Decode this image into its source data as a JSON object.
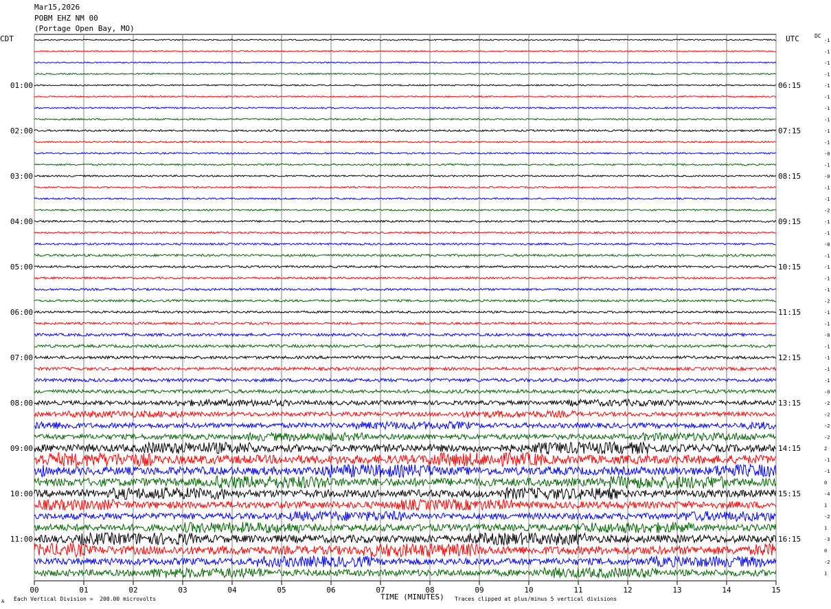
{
  "header": {
    "date": "Mar15,2026",
    "station": "POBM EHZ NM 00",
    "location": "(Portage Open Bay, MO)"
  },
  "left_zone": "CDT",
  "right_zone": "UTC",
  "dc_label": "DC",
  "footer": {
    "scale_note": "Each Vertical Division =  200.00 microvolts",
    "clip_note": "Traces clipped at plus/minus 5 vertical divisions",
    "corner_mark": "A"
  },
  "colors": {
    "trace_cycle": [
      "#000000",
      "#ff0000",
      "#0000ff",
      "#006400"
    ],
    "grid": "#808080"
  },
  "chart_data": {
    "type": "line",
    "title": "",
    "xlabel": "TIME (MINUTES)",
    "ylabel": "",
    "xlim": [
      0,
      15
    ],
    "x_tick_labels": [
      "00",
      "01",
      "02",
      "03",
      "04",
      "05",
      "06",
      "07",
      "08",
      "09",
      "10",
      "11",
      "12",
      "13",
      "14",
      "15"
    ],
    "rows": 48,
    "minutes_per_row": 15,
    "left_hour_labels": [
      "01:00",
      "02:00",
      "03:00",
      "04:00",
      "05:00",
      "06:00",
      "07:00",
      "08:00",
      "09:00",
      "10:00",
      "11:00"
    ],
    "right_hour_labels": [
      "06:15",
      "07:15",
      "08:15",
      "09:15",
      "10:15",
      "11:15",
      "12:15",
      "13:15",
      "14:15",
      "15:15",
      "16:15"
    ],
    "dc_offsets": [
      "-1",
      "-1",
      "-1",
      "-1",
      "-1",
      "-1",
      "-1",
      "-1",
      "-1",
      "-1",
      "-0",
      "-1",
      "-0",
      "-1",
      "-1",
      "-2",
      "-1",
      "-1",
      "-0",
      "-1",
      "-1",
      "-1",
      "-1",
      "-2",
      "-1",
      "-1",
      "-0",
      "-1",
      "-1",
      "-1",
      "-1",
      "-0",
      "-2",
      "-2",
      "-2",
      "-2",
      "2",
      "-1",
      "-1",
      "0",
      "-4",
      "1",
      "-2",
      "1",
      "-3",
      "0",
      "-2",
      "1"
    ],
    "row_amplitude_relative": [
      1,
      1,
      1,
      1.1,
      1.1,
      1.1,
      1.2,
      1.3,
      1.5,
      1.3,
      1.3,
      1.3,
      1.3,
      1.3,
      1.3,
      1.3,
      1.5,
      1.5,
      1.5,
      1.8,
      1.6,
      1.6,
      1.7,
      1.7,
      1.7,
      1.8,
      2.2,
      2.3,
      2.3,
      2.4,
      2.6,
      2.8,
      3.4,
      3.4,
      4,
      4.2,
      6,
      7,
      6.5,
      6.5,
      6,
      5.5,
      5,
      5.5,
      6.2,
      6.8,
      5.5,
      5.2
    ]
  }
}
